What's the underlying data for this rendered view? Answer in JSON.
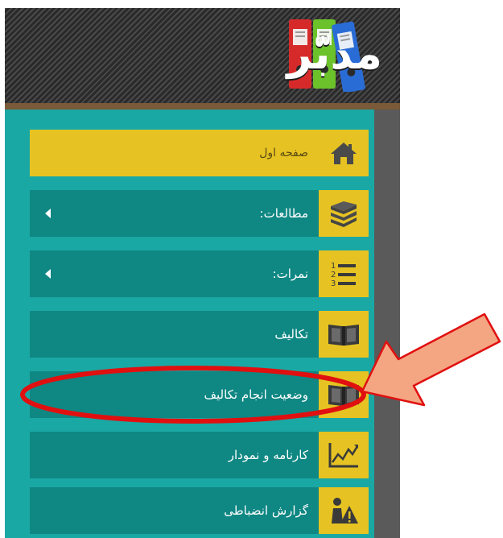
{
  "app": {
    "logo_text": "مدبّر"
  },
  "menu": {
    "items": [
      {
        "label": "صفحه اول",
        "icon": "home-icon",
        "active": true,
        "has_arrow": false
      },
      {
        "label": "مطالعات:",
        "icon": "books-stack-icon",
        "active": false,
        "has_arrow": true
      },
      {
        "label": "نمرات:",
        "icon": "numbered-list-icon",
        "active": false,
        "has_arrow": true
      },
      {
        "label": "تکالیف",
        "icon": "open-book-icon",
        "active": false,
        "has_arrow": false
      },
      {
        "label": "وضعیت انجام تکالیف",
        "icon": "open-book-icon",
        "active": false,
        "has_arrow": false
      },
      {
        "label": "کارنامه و نمودار",
        "icon": "line-chart-icon",
        "active": false,
        "has_arrow": false
      },
      {
        "label": "گزارش انضباطی",
        "icon": "person-warning-icon",
        "active": false,
        "has_arrow": false
      }
    ]
  },
  "colors": {
    "sidebar_bg": "#1aa8a4",
    "item_bg": "#0f8783",
    "accent": "#e6c322",
    "highlight_ellipse": "#e01010",
    "arrow_fill": "#f4a582",
    "arrow_stroke": "#e01010"
  }
}
